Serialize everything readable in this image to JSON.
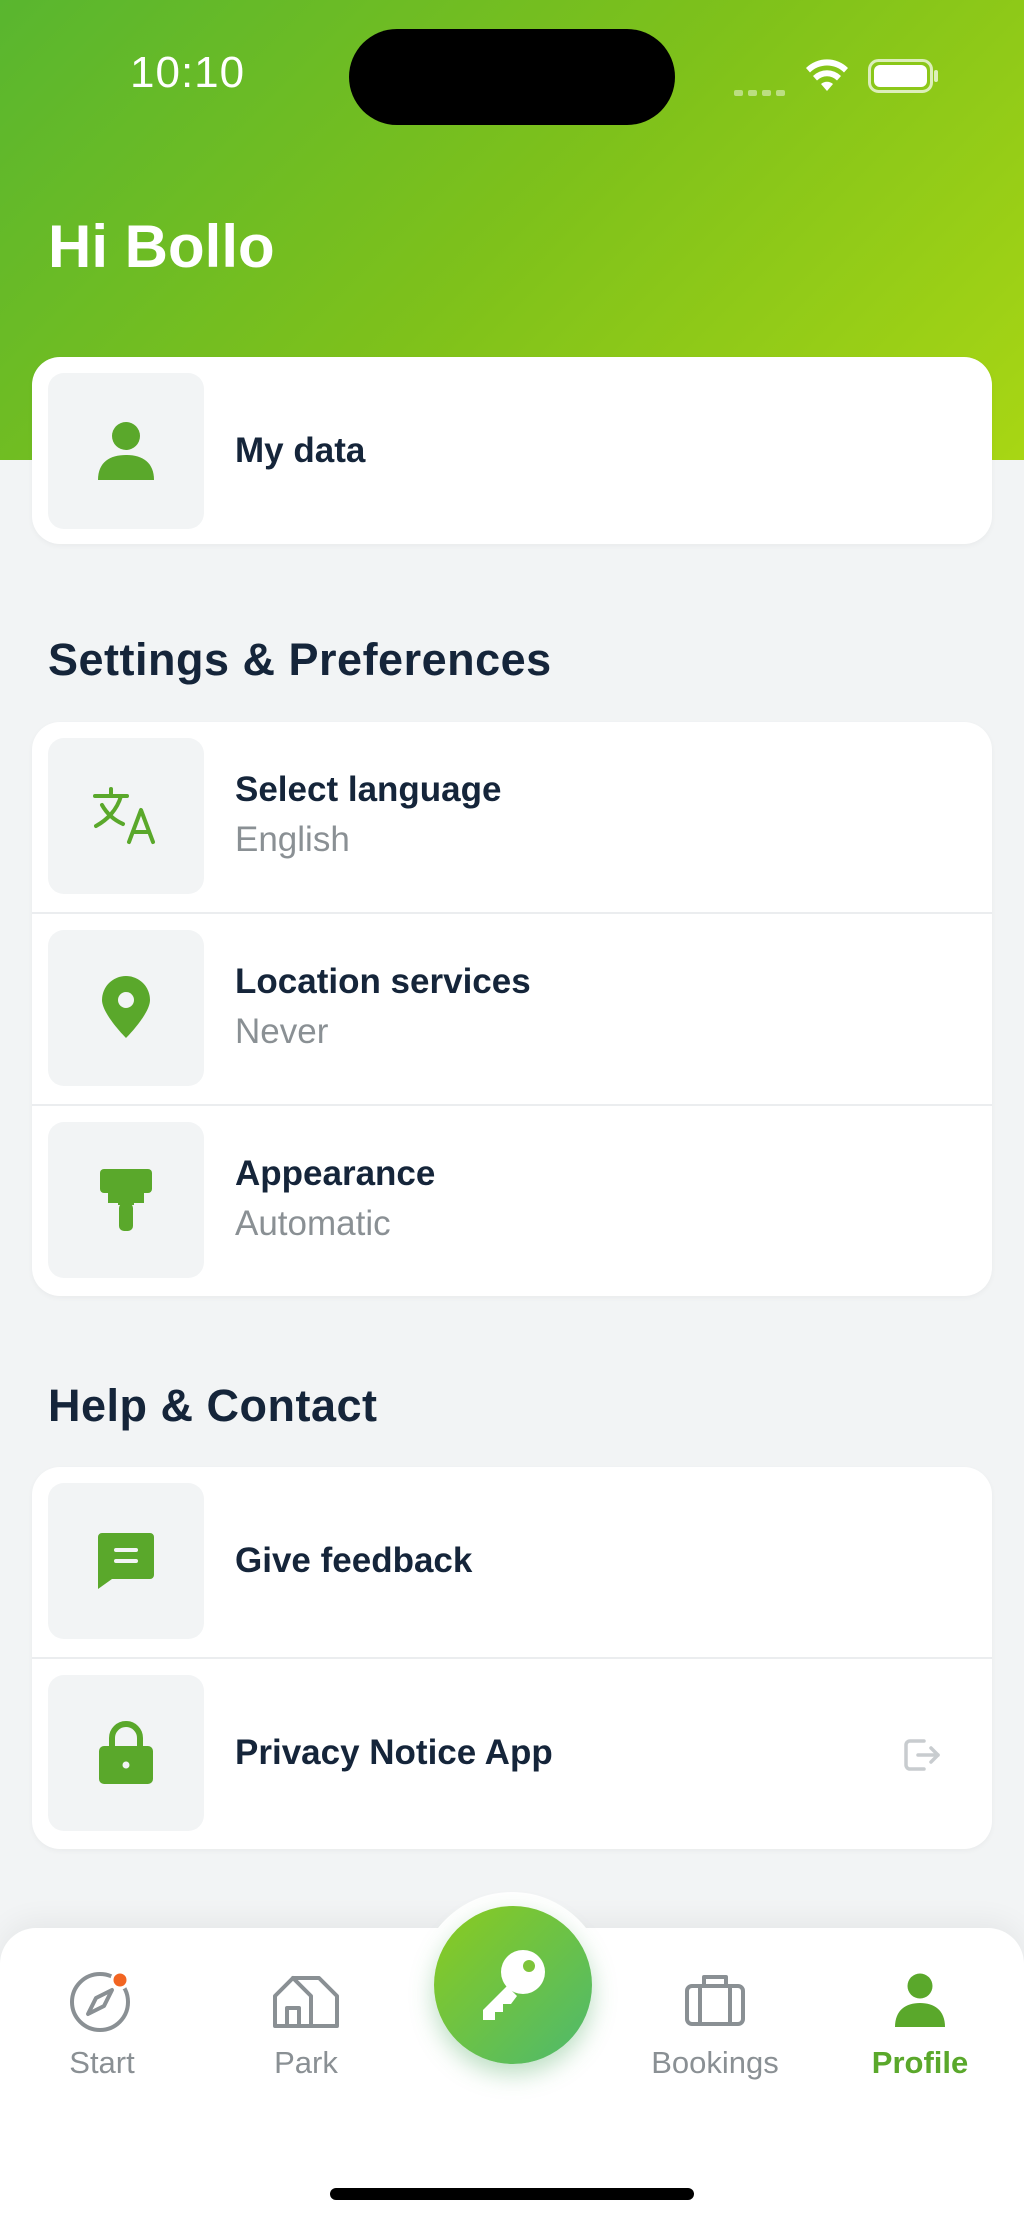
{
  "status_bar": {
    "time": "10:10"
  },
  "header": {
    "greeting": "Hi Bollo"
  },
  "my_data": {
    "label": "My data"
  },
  "settings": {
    "title": "Settings & Preferences",
    "items": [
      {
        "label": "Select language",
        "value": "English"
      },
      {
        "label": "Location services",
        "value": "Never"
      },
      {
        "label": "Appearance",
        "value": "Automatic"
      }
    ]
  },
  "help": {
    "title": "Help & Contact",
    "items": [
      {
        "label": "Give feedback"
      },
      {
        "label": "Privacy Notice App"
      }
    ]
  },
  "tabbar": {
    "items": [
      {
        "label": "Start"
      },
      {
        "label": "Park"
      },
      {
        "label": "Bookings"
      },
      {
        "label": "Profile"
      }
    ],
    "active": "Profile"
  },
  "colors": {
    "brand_green": "#5AA82B",
    "header_gradient_start": "#59B62F",
    "header_gradient_end": "#A8D614",
    "notification_dot": "#F26522"
  }
}
